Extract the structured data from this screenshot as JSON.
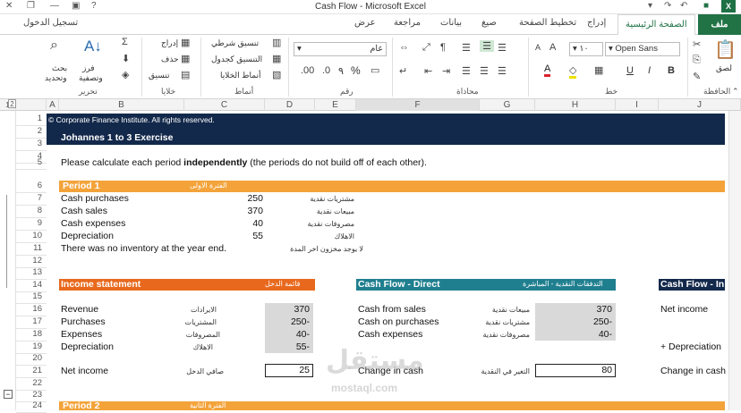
{
  "window": {
    "title": "Cash Flow - Microsoft Excel",
    "help": "?",
    "app_badge": "X"
  },
  "tabs": {
    "file": "ملف",
    "items": [
      "الصفحة الرئيسية",
      "إدراج",
      "تخطيط الصفحة",
      "صيغ",
      "بيانات",
      "مراجعة",
      "عرض"
    ],
    "active_index": 0,
    "sign_in": "تسجيل الدخول"
  },
  "ribbon": {
    "clipboard": {
      "label": "الحافظة",
      "paste": "لصق"
    },
    "font": {
      "label": "خط",
      "family": "Open Sans",
      "size": "١٠",
      "bold": "B",
      "italic": "I",
      "underline": "U"
    },
    "alignment": {
      "label": "محاذاة"
    },
    "number": {
      "label": "رقم",
      "format": "عام",
      "percent": "%",
      "comma": "٩"
    },
    "styles": {
      "label": "أنماط",
      "conditional": "تنسيق شرطي",
      "as_table": "التنسيق كجدول",
      "cell_styles": "أنماط الخلايا"
    },
    "cells": {
      "label": "خلايا",
      "insert": "إدراج",
      "delete": "حذف",
      "format": "تنسيق"
    },
    "editing": {
      "label": "تحرير",
      "sort": "فرز",
      "sort2": "وتصفية",
      "find": "بحث",
      "find2": "وتحديد"
    }
  },
  "sheet": {
    "outline_levels": [
      "1",
      "2"
    ],
    "columns": [
      "A",
      "B",
      "C",
      "D",
      "E",
      "F",
      "G",
      "H",
      "I",
      "J"
    ],
    "rows": [
      "1",
      "2",
      "3",
      "4",
      "5",
      "6",
      "7",
      "8",
      "9",
      "10",
      "11",
      "12",
      "13",
      "14",
      "15",
      "16",
      "17",
      "18",
      "19",
      "20",
      "21",
      "22",
      "23",
      "24"
    ],
    "copyright": "© Corporate Finance Institute. All rights reserved.",
    "exercise_title": "Johannes 1 to 3 Exercise",
    "instruction_pre": "Please calculate each period ",
    "instruction_bold": "independently",
    "instruction_post": " (the periods do not build off of each other).",
    "period1": {
      "title": "Period 1",
      "title_ar": "الفترة الاولى"
    },
    "inputs": [
      {
        "label": "Cash purchases",
        "value": "250",
        "ar": "مشتريات نقدية"
      },
      {
        "label": "Cash sales",
        "value": "370",
        "ar": "مبيعات نقدية"
      },
      {
        "label": "Cash expenses",
        "value": "40",
        "ar": "مصروفات نقدية"
      },
      {
        "label": "Depreciation",
        "value": "55",
        "ar": "الاهلاك"
      }
    ],
    "inventory_note": "There was no inventory at the year end.",
    "inventory_note_ar": "لا يوجد مخزون اخر المدة",
    "income_statement": {
      "title": "Income statement",
      "title_ar": "قائمة الدخل",
      "rows": [
        {
          "label": "Revenue",
          "ar": "الايرادات",
          "value": "370"
        },
        {
          "label": "Purchases",
          "ar": "المشتريات",
          "value": "-250"
        },
        {
          "label": "Expenses",
          "ar": "المصروفات",
          "value": "-40"
        },
        {
          "label": "Depreciation",
          "ar": "الاهلاك",
          "value": "-55"
        }
      ],
      "net_label": "Net income",
      "net_ar": "صافي الدخل",
      "net_value": "25"
    },
    "cash_flow_direct": {
      "title": "Cash Flow - Direct",
      "title_ar": "التدفقات النقدية - المباشرة",
      "rows": [
        {
          "label": "Cash from sales",
          "ar": "مبيعات نقدية",
          "value": "370"
        },
        {
          "label": "Cash on purchases",
          "ar": "مشتريات نقدية",
          "value": "-250"
        },
        {
          "label": "Cash expenses",
          "ar": "مصروفات نقدية",
          "value": "-40"
        }
      ],
      "change_label": "Change in cash",
      "change_ar": "التغير في النقدية",
      "change_value": "80"
    },
    "cash_flow_indirect": {
      "title": "Cash Flow - In",
      "net_income": "Net income",
      "depreciation": "+ Depreciation",
      "change": "Change in cash"
    },
    "period2": {
      "title": "Period 2",
      "title_ar": "الفترة الثانية"
    },
    "watermark": "mostaql.com",
    "watermark_ar": "مستقل"
  },
  "colors": {
    "accent": "#217346",
    "navy": "#13294b",
    "orange": "#f3a33a",
    "orange_dark": "#e8691e",
    "teal": "#1f7f8f"
  }
}
